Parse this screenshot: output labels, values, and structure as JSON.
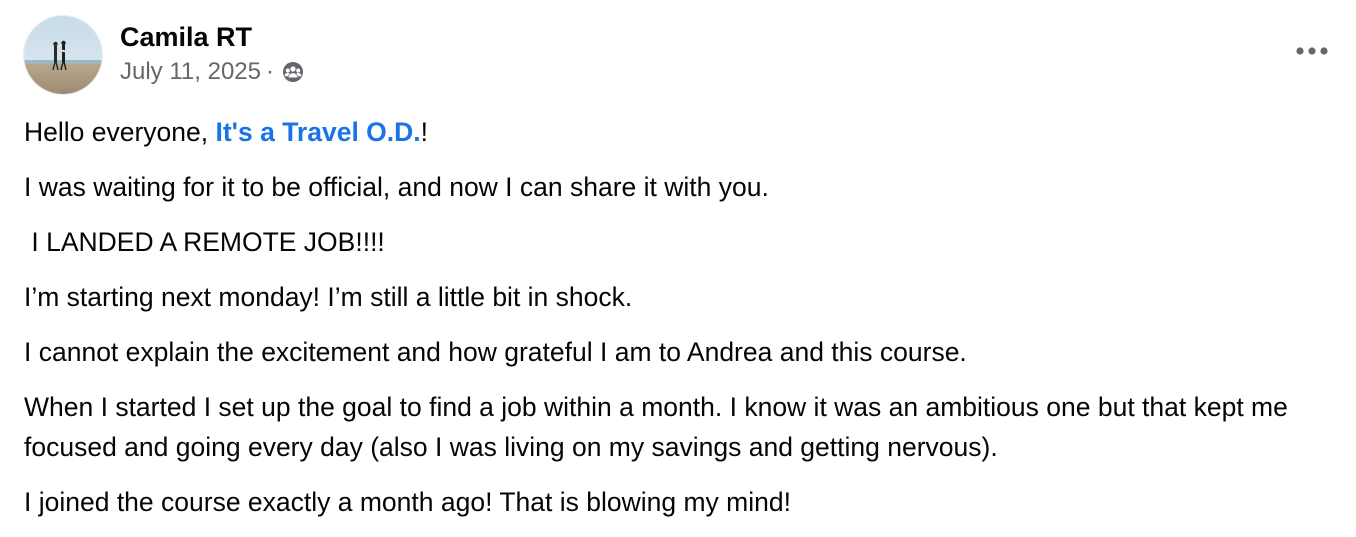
{
  "post": {
    "author": "Camila RT",
    "date": "July 11, 2025",
    "separator": "·",
    "audience_icon": "group-members-icon",
    "more_icon": "more-options-icon",
    "intro_prefix": "Hello everyone, ",
    "intro_link": "It's a Travel O.D.",
    "intro_suffix": "!",
    "paragraphs": [
      "I was waiting for it to be official, and now I can share it with you.",
      " I LANDED A REMOTE JOB!!!!",
      "I’m starting next monday! I’m still a little bit in shock.",
      "I cannot explain the excitement and how grateful I am to Andrea and this course.",
      "When I started I set up the goal to find a job within a month. I know it was an ambitious one but that kept me focused and going every day (also I was living on my savings and getting nervous).",
      "I joined the course exactly a month ago! That is blowing my mind!"
    ]
  },
  "colors": {
    "link": "#1b74e4",
    "secondary_text": "#65676b",
    "primary_text": "#050505"
  }
}
